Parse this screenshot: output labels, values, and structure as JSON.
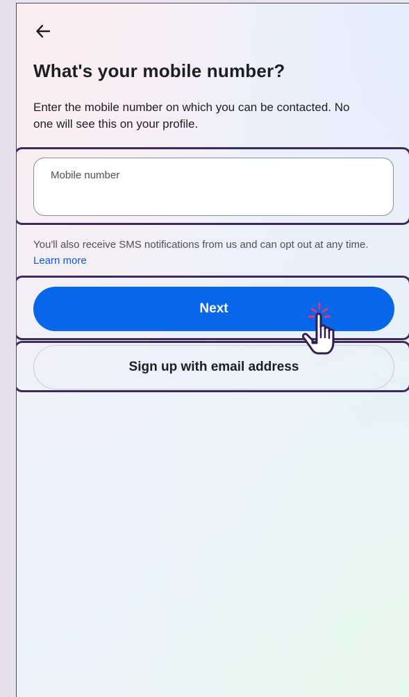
{
  "header": {
    "back_icon": "arrow-left-icon"
  },
  "page": {
    "title": "What's your mobile number?",
    "subtitle": "Enter the mobile number on which you can be contacted. No one will see this on your profile."
  },
  "mobile_input": {
    "label": "Mobile number",
    "value": ""
  },
  "notice": {
    "text": "You'll also receive SMS notifications from us and can opt out at any time.",
    "link_label": "Learn more"
  },
  "buttons": {
    "next_label": "Next",
    "email_label": "Sign up with email address"
  },
  "colors": {
    "primary": "#0866e8",
    "link": "#0a5ad8",
    "highlight": "#3b2a5a"
  },
  "overlay": {
    "cursor_icon": "pointing-hand-click-icon"
  }
}
